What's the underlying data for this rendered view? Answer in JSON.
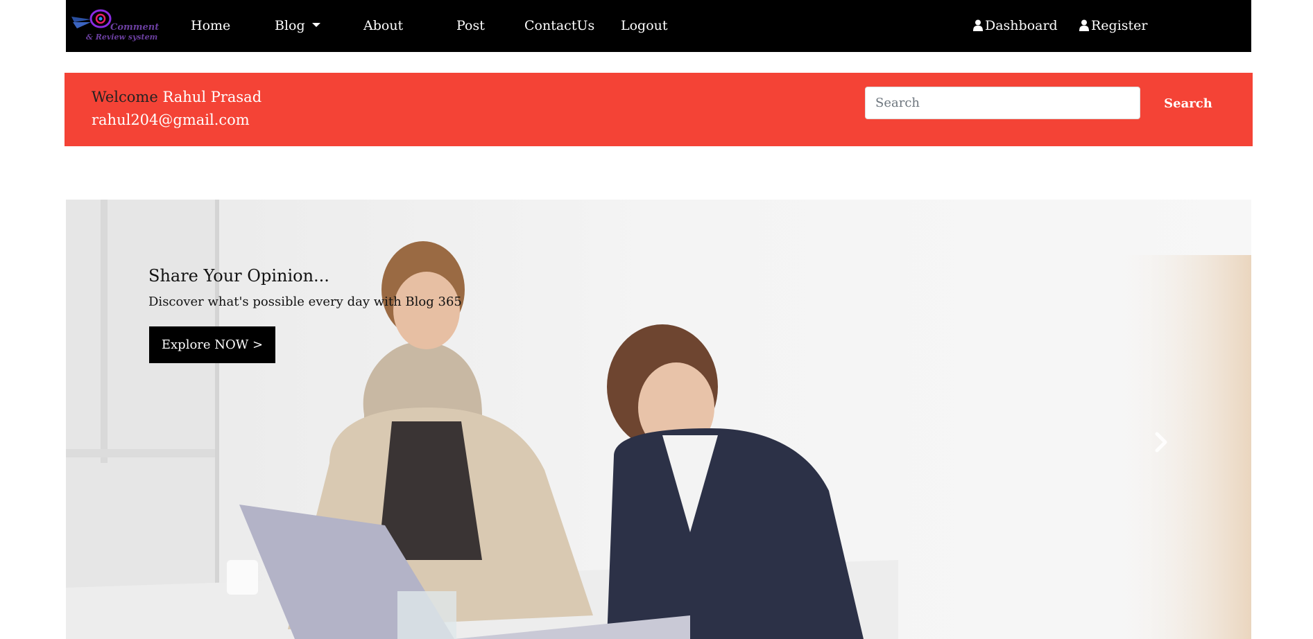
{
  "navbar": {
    "logo": {
      "line1": "Comment",
      "line2": "& Review system"
    },
    "items": [
      {
        "label": "Home"
      },
      {
        "label": "Blog"
      },
      {
        "label": "About"
      },
      {
        "label": "Post"
      },
      {
        "label": "ContactUs"
      },
      {
        "label": "Logout"
      }
    ],
    "right_items": [
      {
        "label": "Dashboard",
        "icon": "user-icon"
      },
      {
        "label": "Register",
        "icon": "user-icon"
      }
    ]
  },
  "welcome": {
    "prefix": "Welcome",
    "name": "Rahul Prasad",
    "email": "rahul204@gmail.com"
  },
  "search": {
    "placeholder": "Search",
    "button_label": "Search"
  },
  "hero": {
    "title": "Share Your Opinion...",
    "subtitle": "Discover what's possible every day with Blog 365",
    "button_label": "Explore NOW >",
    "next_icon": "chevron-right-icon"
  },
  "colors": {
    "navbar_bg": "#000000",
    "welcome_bg": "#f44336",
    "button_bg": "#000000"
  }
}
